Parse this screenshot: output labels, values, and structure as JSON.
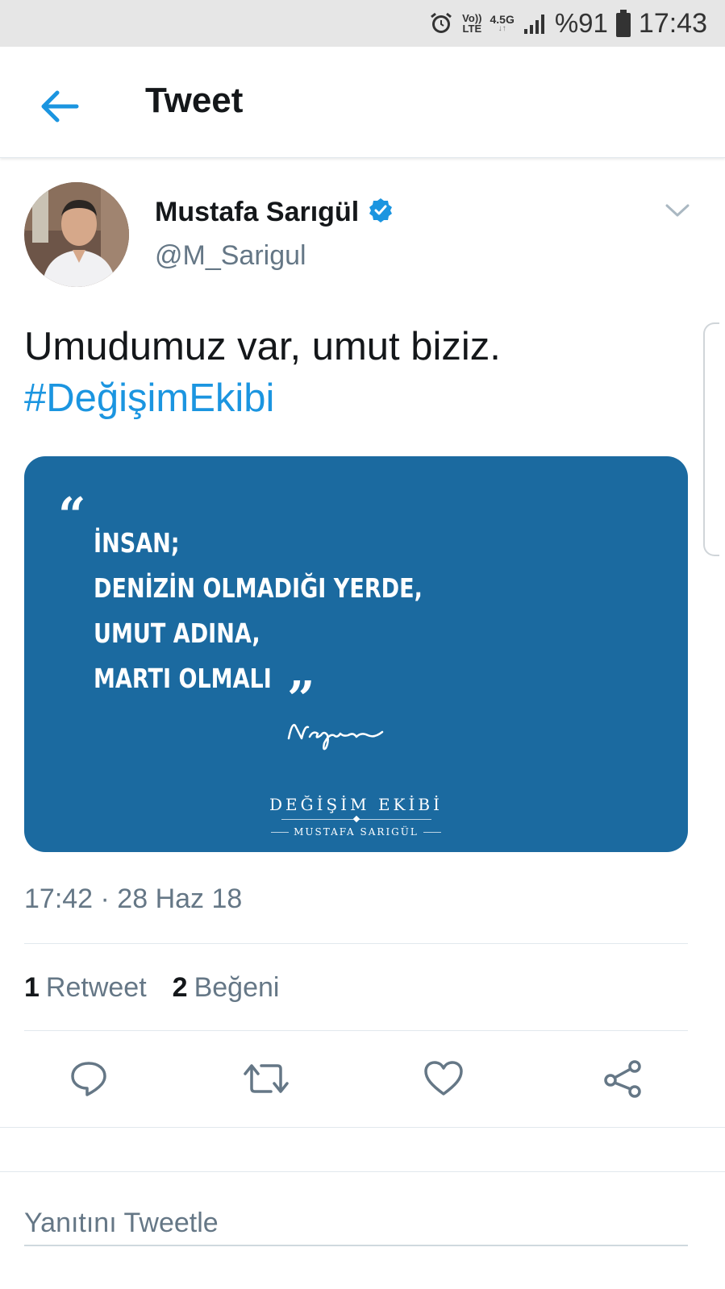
{
  "status_bar": {
    "alarm_icon": "alarm-clock-icon",
    "volte_top": "Vo))",
    "volte_bottom": "LTE",
    "network": "4.5G",
    "signal_icon": "signal-bars-icon",
    "battery_text": "%91",
    "battery_icon": "battery-icon",
    "time": "17:43"
  },
  "appbar": {
    "back_icon": "arrow-left-icon",
    "title": "Tweet"
  },
  "tweet": {
    "author_name": "Mustafa Sarıgül",
    "verified_icon": "verified-badge-icon",
    "handle": "@M_Sarigul",
    "text": "Umudumuz var, umut biziz.",
    "hashtag": "#DeğişimEkibi",
    "timestamp": "17:42 · 28 Haz 18",
    "retweets": {
      "count": "1",
      "label": "Retweet"
    },
    "likes": {
      "count": "2",
      "label": "Beğeni"
    }
  },
  "media": {
    "quote_lines": [
      "İNSAN;",
      "DENİZİN OLMADIĞI YERDE,",
      "UMUT ADINA,",
      "MARTI OLMALI"
    ],
    "signature": "Nagihan",
    "brand_title": "DEĞİŞİM EKİBİ",
    "brand_sub": "MUSTAFA SARIGÜL"
  },
  "actions": [
    "reply-icon",
    "retweet-icon",
    "like-icon",
    "share-icon"
  ],
  "reply": {
    "placeholder": "Yanıtını Tweetle"
  },
  "colors": {
    "accent": "#1b95e0",
    "media_bg": "#1b6aa0",
    "secondary_text": "#657786"
  }
}
